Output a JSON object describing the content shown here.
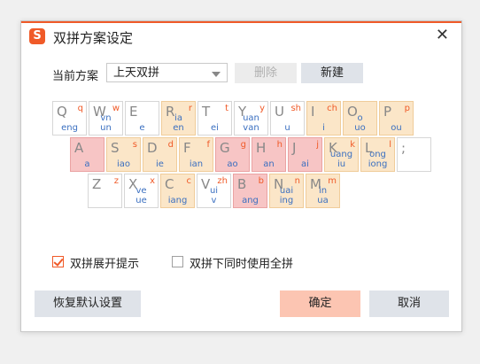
{
  "window": {
    "title": "双拼方案设定",
    "close_glyph": "✕",
    "logo_glyph": "S",
    "accent": "#f05a28"
  },
  "scheme": {
    "label": "当前方案",
    "selected": "上天双拼",
    "delete_label": "删除",
    "new_label": "新建"
  },
  "keyboard": {
    "rows": [
      [
        {
          "k": "Q",
          "i": "q",
          "f": "eng",
          "s": 0
        },
        {
          "k": "W",
          "i": "w",
          "f": "vn\nun",
          "s": 0
        },
        {
          "k": "E",
          "i": "",
          "f": "e",
          "s": 0
        },
        {
          "k": "R",
          "i": "r",
          "f": "ia\nen",
          "s": 1
        },
        {
          "k": "T",
          "i": "t",
          "f": "ei",
          "s": 0
        },
        {
          "k": "Y",
          "i": "y",
          "f": "uan\nvan",
          "s": 0
        },
        {
          "k": "U",
          "i": "sh",
          "f": "u",
          "s": 0
        },
        {
          "k": "I",
          "i": "ch",
          "f": "i",
          "s": 1
        },
        {
          "k": "O",
          "i": "",
          "f": "o\nuo",
          "s": 1
        },
        {
          "k": "P",
          "i": "p",
          "f": "ou",
          "s": 1
        }
      ],
      [
        {
          "k": "A",
          "i": "",
          "f": "a",
          "s": 2
        },
        {
          "k": "S",
          "i": "s",
          "f": "iao",
          "s": 1
        },
        {
          "k": "D",
          "i": "d",
          "f": "ie",
          "s": 1
        },
        {
          "k": "F",
          "i": "f",
          "f": "ian",
          "s": 1
        },
        {
          "k": "G",
          "i": "g",
          "f": "ao",
          "s": 2
        },
        {
          "k": "H",
          "i": "h",
          "f": "an",
          "s": 2
        },
        {
          "k": "J",
          "i": "j",
          "f": "ai",
          "s": 2
        },
        {
          "k": "K",
          "i": "k",
          "f": "uang\niu",
          "s": 1
        },
        {
          "k": "L",
          "i": "l",
          "f": "ong\niong",
          "s": 1
        },
        {
          "k": ";",
          "i": "",
          "f": "",
          "s": 0
        }
      ],
      [
        {
          "k": "Z",
          "i": "z",
          "f": "",
          "s": 0
        },
        {
          "k": "X",
          "i": "x",
          "f": "ve\nue",
          "s": 0
        },
        {
          "k": "C",
          "i": "c",
          "f": "iang",
          "s": 1
        },
        {
          "k": "V",
          "i": "zh",
          "f": "ui\nv",
          "s": 0
        },
        {
          "k": "B",
          "i": "b",
          "f": "ang",
          "s": 2
        },
        {
          "k": "N",
          "i": "n",
          "f": "uai\ning",
          "s": 1
        },
        {
          "k": "M",
          "i": "m",
          "f": "in\nua",
          "s": 1
        }
      ]
    ]
  },
  "options": {
    "expand_hint": {
      "label": "双拼展开提示",
      "checked": true
    },
    "use_full_pinyin": {
      "label": "双拼下同时使用全拼",
      "checked": false
    }
  },
  "buttons": {
    "reset": "恢复默认设置",
    "ok": "确定",
    "cancel": "取消"
  }
}
